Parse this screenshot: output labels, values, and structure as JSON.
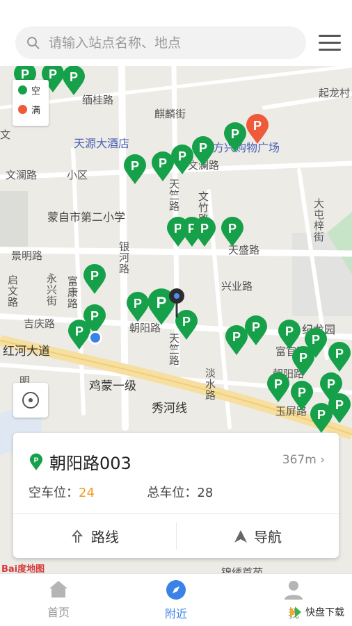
{
  "search": {
    "placeholder": "请输入站点名称、地点"
  },
  "legend": {
    "free_label": "空",
    "full_label": "满",
    "free_color": "#17a04a",
    "full_color": "#ee5a3a"
  },
  "map_labels": {
    "l1": "起龙村",
    "l2": "缅桂路",
    "l3": "麒麟街",
    "l4": "天源大酒店",
    "l5": "方兴购物广场",
    "l6": "文澜路",
    "l7": "小区",
    "l8": "文澜路",
    "l9": "天竺路",
    "l10": "文竹路",
    "l11": "蒙自市第二小学",
    "l12": "大屯梓街",
    "l13": "景明路",
    "l14": "银河路",
    "l15": "天盛路",
    "l16": "启文路",
    "l17": "永兴街",
    "l18": "富康路",
    "l19": "兴业路",
    "l20": "吉庆路",
    "l21": "朝阳路",
    "l22": "纪龙园",
    "l23": "天竺路",
    "l24": "红河大道",
    "l25": "富官路",
    "l26": "朝阳路",
    "l27": "淡水路",
    "l28": "鸡蒙一级",
    "l29": "秀河线",
    "l30": "玉屏路",
    "l31": "锦绣首苑",
    "l32": "文",
    "l33": "明"
  },
  "card": {
    "station_name": "朝阳路003",
    "distance": "367m",
    "free_label": "空车位：",
    "free_count": "24",
    "total_label": "总车位：",
    "total_count": "28",
    "route_label": "路线",
    "nav_label": "导航"
  },
  "baidu_logo": "Bai度地图",
  "tabs": [
    {
      "label": "首页"
    },
    {
      "label": "附近"
    },
    {
      "label": "我"
    }
  ],
  "watermark": "快盘下载"
}
